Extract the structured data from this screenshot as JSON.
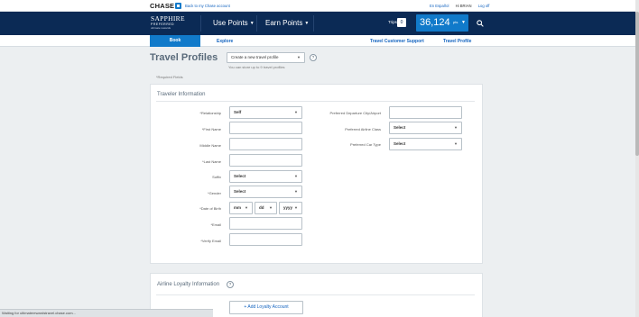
{
  "topbar": {
    "brand": "CHASE",
    "back_link": "Back to my Chase account",
    "en_espanol": "En Español",
    "greeting": "Hi BRIAN",
    "logout": "Log off"
  },
  "header": {
    "brand_line1": "SAPPHIRE",
    "brand_line2": "PREFERRED",
    "brand_line3": "ultimate rewards",
    "nav": [
      "Use Points",
      "Earn Points"
    ],
    "trips_label": "Trips",
    "trips_count": "0",
    "points": "36,124",
    "points_unit": "pts"
  },
  "subnav": {
    "book": "Book",
    "explore": "Explore",
    "support": "Travel Customer Support",
    "profile": "Travel Profile"
  },
  "page": {
    "title": "Travel Profiles",
    "profile_select": "Create a new travel profile",
    "profile_note": "You can store up to 9 travel profiles",
    "required_note": "*Required Fields"
  },
  "traveler": {
    "section_title": "Traveler Information",
    "labels": {
      "relationship": "*Relationship",
      "first_name": "*First Name",
      "middle_name": "Middle Name",
      "last_name": "*Last Name",
      "suffix": "Suffix",
      "gender": "*Gender",
      "dob": "*Date of Birth",
      "email": "*Email",
      "verify_email": "*Verify Email",
      "departure_city": "Preferred Departure City/Airport",
      "airline_class": "Preferred Airline Class",
      "car_type": "Preferred Car Type"
    },
    "values": {
      "relationship": "Self",
      "suffix": "Select",
      "gender": "Select",
      "dob_mm": "mm",
      "dob_dd": "dd",
      "dob_yyyy": "yyyy",
      "airline_class": "Select",
      "car_type": "Select"
    }
  },
  "loyalty": {
    "section_title": "Airline Loyalty Information",
    "add_button": "+ Add Loyalty Account"
  },
  "status_bar": "Waiting for ultimaterewardstravel.chase.com...",
  "colors": {
    "navy": "#0b2a55",
    "accent": "#117aca",
    "link": "#1565c0"
  }
}
